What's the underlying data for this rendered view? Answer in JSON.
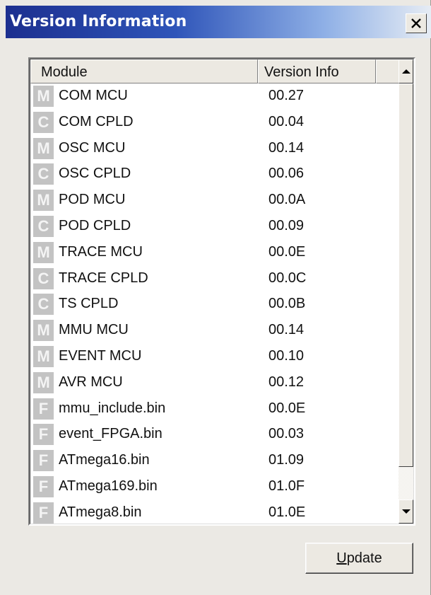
{
  "window": {
    "title": "Version Information",
    "close_glyph": "×"
  },
  "list": {
    "columns": [
      "Module",
      "Version Info"
    ],
    "rows": [
      {
        "badge": "M",
        "module": "COM MCU",
        "version": "00.27"
      },
      {
        "badge": "C",
        "module": "COM CPLD",
        "version": "00.04"
      },
      {
        "badge": "M",
        "module": "OSC MCU",
        "version": "00.14"
      },
      {
        "badge": "C",
        "module": "OSC CPLD",
        "version": "00.06"
      },
      {
        "badge": "M",
        "module": "POD MCU",
        "version": "00.0A"
      },
      {
        "badge": "C",
        "module": "POD CPLD",
        "version": "00.09"
      },
      {
        "badge": "M",
        "module": "TRACE MCU",
        "version": "00.0E"
      },
      {
        "badge": "C",
        "module": "TRACE CPLD",
        "version": "00.0C"
      },
      {
        "badge": "C",
        "module": "TS CPLD",
        "version": "00.0B"
      },
      {
        "badge": "M",
        "module": "MMU MCU",
        "version": "00.14"
      },
      {
        "badge": "M",
        "module": "EVENT MCU",
        "version": "00.10"
      },
      {
        "badge": "M",
        "module": "AVR MCU",
        "version": "00.12"
      },
      {
        "badge": "F",
        "module": "mmu_include.bin",
        "version": "00.0E"
      },
      {
        "badge": "F",
        "module": "event_FPGA.bin",
        "version": "00.03"
      },
      {
        "badge": "F",
        "module": "ATmega16.bin",
        "version": "01.09"
      },
      {
        "badge": "F",
        "module": "ATmega169.bin",
        "version": "01.0F"
      },
      {
        "badge": "F",
        "module": "ATmega8.bin",
        "version": "01.0E"
      }
    ]
  },
  "buttons": {
    "update_accel": "U",
    "update_rest": "pdate"
  },
  "icons": {
    "close": "close-icon",
    "scroll_up": "arrow-up-icon",
    "scroll_down": "arrow-down-icon"
  },
  "colors": {
    "title_gradient_start": "#1c2f8f",
    "title_gradient_end": "#e6ecf4",
    "badge": "#c3c3c3",
    "dialog_face": "#ebe9e4"
  }
}
